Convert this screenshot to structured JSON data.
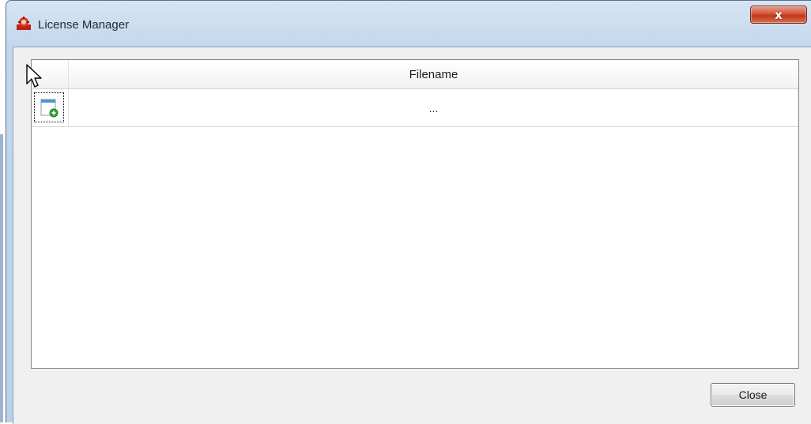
{
  "window": {
    "title": "License Manager",
    "close_glyph": "x"
  },
  "table": {
    "columns": [
      "Filename"
    ],
    "rows": [
      {
        "filename": "..."
      }
    ]
  },
  "add_button_icon": "add-file-icon",
  "footer": {
    "close_label": "Close"
  },
  "colors": {
    "titlebar": "#c2d7ec",
    "close_button_red": "#c2361b",
    "client_background": "#f0f0f0"
  }
}
